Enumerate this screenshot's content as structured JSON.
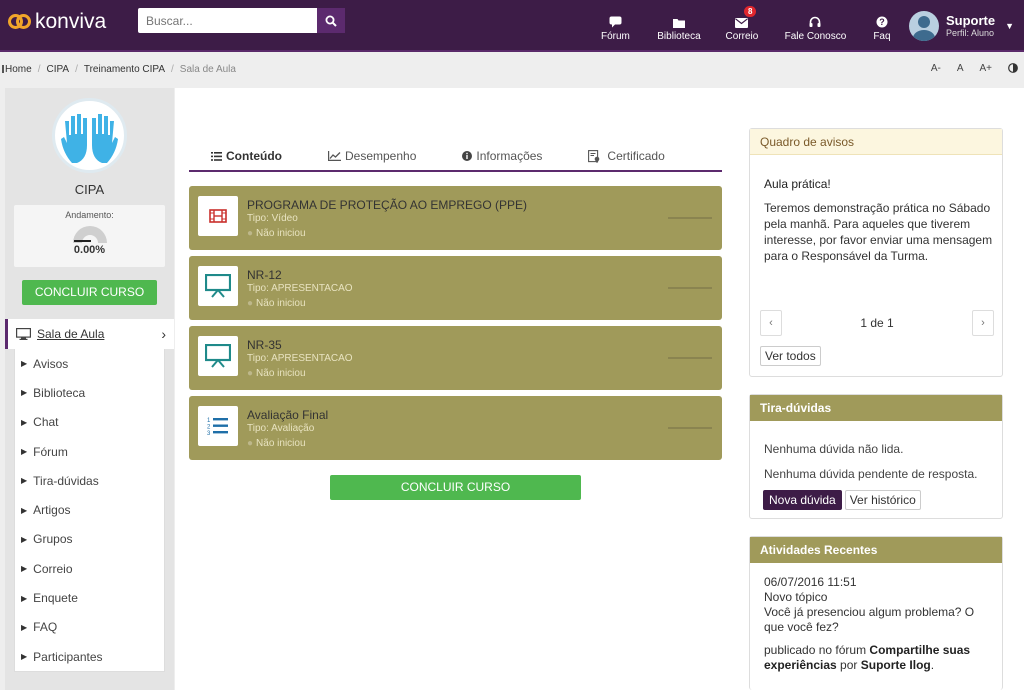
{
  "header": {
    "logo_text": "konviva",
    "search_placeholder": "Buscar...",
    "nav": [
      {
        "label": "Fórum",
        "icon": "chat-bubble-icon"
      },
      {
        "label": "Biblioteca",
        "icon": "folder-icon"
      },
      {
        "label": "Correio",
        "icon": "envelope-icon",
        "badge": "8"
      },
      {
        "label": "Fale Conosco",
        "icon": "headset-icon"
      },
      {
        "label": "Faq",
        "icon": "question-circle-icon"
      }
    ],
    "user": {
      "name": "Suporte",
      "role": "Perfil: Aluno"
    }
  },
  "breadcrumb": {
    "items": [
      "Home",
      "CIPA",
      "Treinamento CIPA"
    ],
    "current": "Sala de Aula"
  },
  "font_tools": [
    "A-",
    "A",
    "A+"
  ],
  "sidebar": {
    "course_name": "CIPA",
    "progress_label": "Andamento:",
    "progress_value": "0.00%",
    "progress_fraction": 0,
    "conclude_label": "CONCLUIR CURSO",
    "active_item": "Sala de Aula",
    "menu": [
      "Avisos",
      "Biblioteca",
      "Chat",
      "Fórum",
      "Tira-dúvidas",
      "Artigos",
      "Grupos",
      "Correio",
      "Enquete",
      "FAQ",
      "Participantes"
    ]
  },
  "tabs": [
    {
      "label": "Conteúdo",
      "icon": "list-icon",
      "active": true
    },
    {
      "label": "Desempenho",
      "icon": "line-chart-icon",
      "active": false
    },
    {
      "label": "Informações",
      "icon": "info-circle-icon",
      "active": false
    },
    {
      "label": "Certificado",
      "icon": "certificate-icon",
      "active": false
    }
  ],
  "content_items": [
    {
      "title": "PROGRAMA DE PROTEÇÃO AO EMPREGO (PPE)",
      "type": "Tipo: Vídeo",
      "status": "Não iniciou",
      "icon": "film-icon"
    },
    {
      "title": "NR-12",
      "type": "Tipo: APRESENTACAO",
      "status": "Não iniciou",
      "icon": "presentation-icon"
    },
    {
      "title": "NR-35",
      "type": "Tipo: APRESENTACAO",
      "status": "Não iniciou",
      "icon": "presentation-icon"
    },
    {
      "title": "Avaliação Final",
      "type": "Tipo: Avaliação",
      "status": "Não iniciou",
      "icon": "numbered-list-icon"
    }
  ],
  "main_conclude_label": "CONCLUIR CURSO",
  "notices": {
    "title": "Quadro de avisos",
    "notice_title": "Aula prática!",
    "notice_body": "Teremos demonstração prática no Sábado pela manhã. Para aqueles que tiverem interesse, por favor enviar uma mensagem para o Responsável da Turma.",
    "pager": "1 de 1",
    "see_all": "Ver todos"
  },
  "doubts": {
    "title": "Tira-dúvidas",
    "line1": "Nenhuma dúvida não lida.",
    "line2": "Nenhuma dúvida pendente de resposta.",
    "new_button": "Nova dúvida",
    "history_button": "Ver histórico"
  },
  "recent": {
    "title": "Atividades Recentes",
    "date": "06/07/2016 11:51",
    "kind": "Novo tópico",
    "text": "Você já presenciou algum problema? O que você fez?",
    "prefix": "publicado no fórum ",
    "forum": "Compartilhe suas experiências",
    "by": " por ",
    "author": "Suporte Ilog",
    "suffix": "."
  },
  "colors": {
    "brand": "#3d1c47",
    "olive": "#a09a5a",
    "green": "#4fb84f",
    "badge": "#e0262d"
  }
}
